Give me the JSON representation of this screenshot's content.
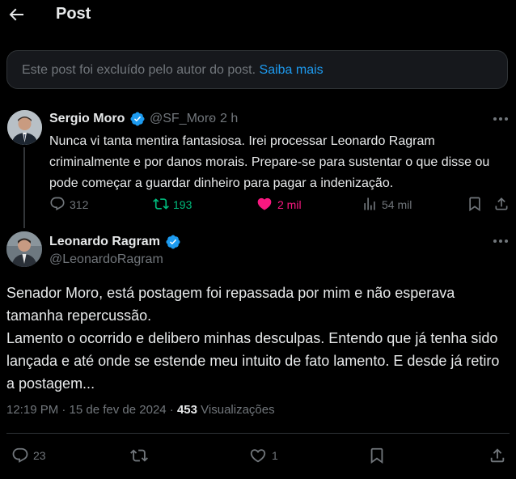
{
  "header": {
    "title": "Post"
  },
  "deleted_notice": {
    "text": "Este post foi excluído pelo autor do post. ",
    "link": "Saiba mais"
  },
  "quoted_post": {
    "author_name": "Sergio Moro",
    "handle": "@SF_Moro",
    "separator": "·",
    "time": "2 h",
    "text": "Nunca vi tanta mentira fantasiosa. Irei processar Leonardo Ragram criminalmente e por danos morais. Prepare-se para sustentar o que disse ou pode começar a guardar dinheiro para pagar a indenização.",
    "replies": "312",
    "reposts": "193",
    "likes": "2 mil",
    "views": "54 mil"
  },
  "main_post": {
    "author_name": "Leonardo Ragram",
    "handle": "@LeonardoRagram",
    "text": "Senador Moro, está postagem foi repassada por mim e não esperava tamanha repercussão.\nLamento o ocorrido e delibero minhas desculpas. Entendo que já tenha sido lançada e até onde se estende meu intuito  de fato lamento. E desde já retiro a postagem...",
    "timestamp": "12:19 PM · 15 de fev de 2024 · ",
    "views_count": "453",
    "views_label": " Visualizações",
    "replies": "23",
    "likes": "1"
  },
  "colors": {
    "background": "#000000",
    "text": "#e7e9ea",
    "muted": "#71767b",
    "accent": "#1d9bf0",
    "repost_active": "#00ba7c",
    "like_active": "#f91880"
  }
}
